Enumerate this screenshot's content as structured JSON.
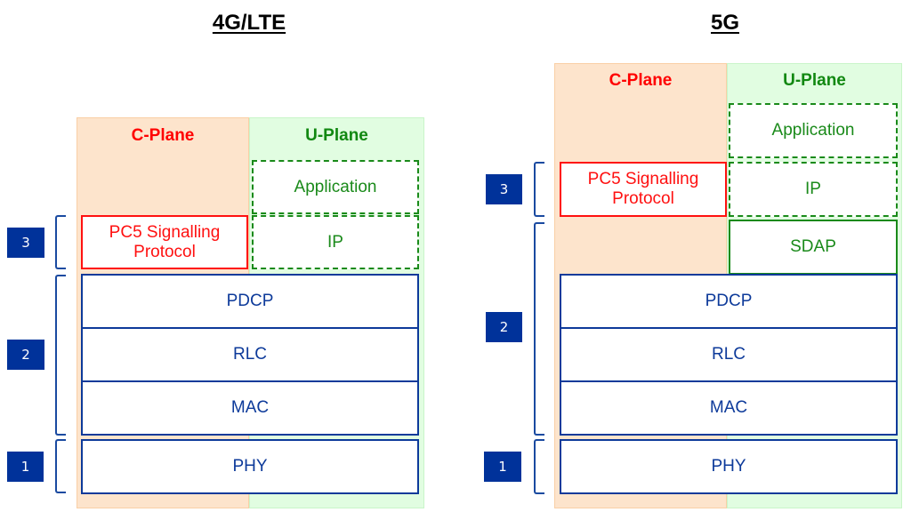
{
  "diagrams": [
    {
      "title": "4G/LTE",
      "c_plane_label": "C-Plane",
      "u_plane_label": "U-Plane",
      "layers": {
        "application": "Application",
        "pc5": "PC5 Signalling Protocol",
        "ip": "IP",
        "pdcp": "PDCP",
        "rlc": "RLC",
        "mac": "MAC",
        "phy": "PHY"
      },
      "badges": [
        "3",
        "2",
        "1"
      ]
    },
    {
      "title": "5G",
      "c_plane_label": "C-Plane",
      "u_plane_label": "U-Plane",
      "layers": {
        "application": "Application",
        "pc5": "PC5 Signalling Protocol",
        "ip": "IP",
        "sdap": "SDAP",
        "pdcp": "PDCP",
        "rlc": "RLC",
        "mac": "MAC",
        "phy": "PHY"
      },
      "badges": [
        "3",
        "2",
        "1"
      ]
    }
  ],
  "colors": {
    "c_plane": "#ff0000",
    "u_plane": "#1a8a1a",
    "lower_layers": "#0d3a9a",
    "badge": "#00329a",
    "c_plane_bg": "#fde4cc",
    "u_plane_bg": "#e1fde1"
  }
}
